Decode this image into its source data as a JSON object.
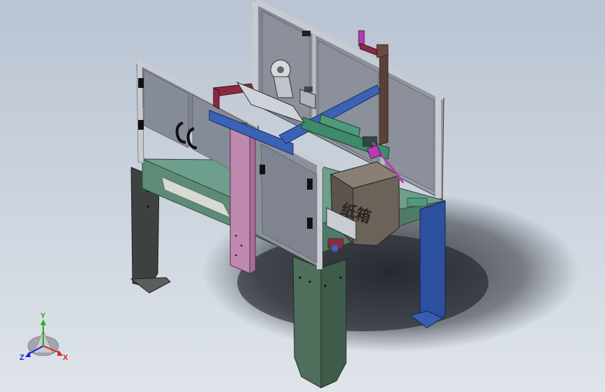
{
  "viewport": {
    "background_top": "#b9c3d2",
    "background_bottom": "#dfe4ea"
  },
  "model": {
    "carton_label": "纸箱",
    "colors": {
      "frame": "#9aa0aa",
      "panel": "#8a8f9c",
      "table": "#6e9e8c",
      "leg_dark": "#3d4240",
      "leg_green": "#4f6e5c",
      "leg_blue": "#2d4fa0",
      "pink_post": "#c08ab0",
      "blue_beam": "#3b62b4",
      "green_rail": "#3e8a6a",
      "carton": "#5c544d",
      "red_arm": "#8a2a40",
      "magenta_part": "#b43cb4"
    }
  },
  "triad": {
    "x_label": "X",
    "y_label": "Y",
    "z_label": "Z",
    "x_color": "#e02020",
    "y_color": "#20b020",
    "z_color": "#2020e0"
  }
}
